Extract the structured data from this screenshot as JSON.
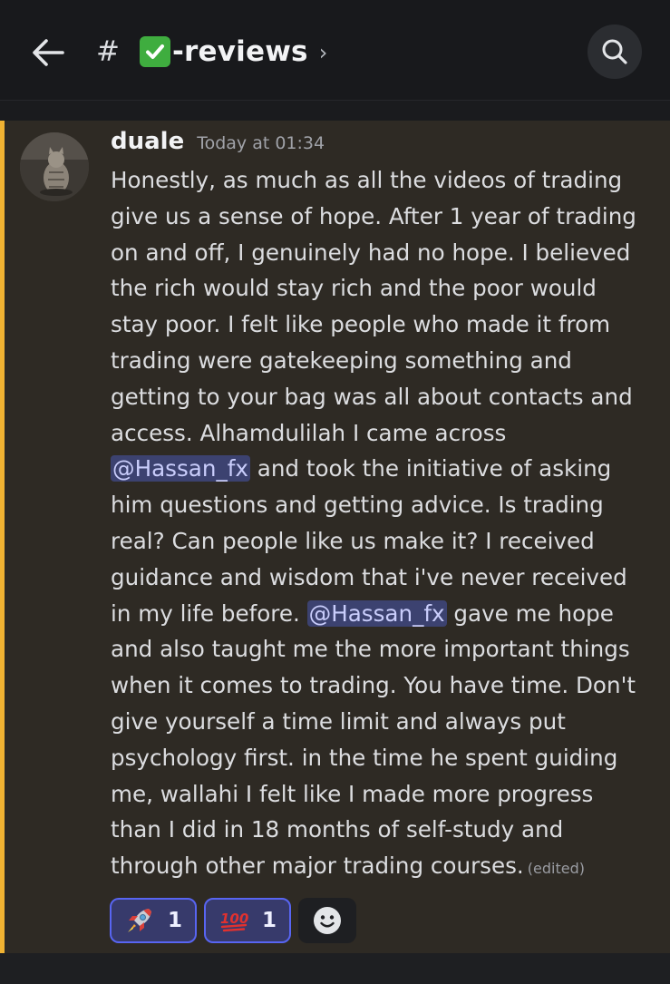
{
  "header": {
    "hash_symbol": "#",
    "channel_emoji": "white-check-mark-icon",
    "channel_name": "-reviews",
    "chevron": "›"
  },
  "message": {
    "author": "duale",
    "timestamp": "Today at 01:34",
    "lines": [
      "Honestly, as much as all the videos of trading",
      "give us a sense of hope. After 1 year of trading",
      "on and off, I genuinely had no hope. I believed",
      "the rich would stay rich and the poor would",
      "stay poor. I felt like people who made it from",
      "trading were gatekeeping something and",
      "getting to your bag was all about contacts and",
      "access. Alhamdulilah I came across"
    ],
    "mention1": "@Hassan_fx",
    "line9_rest": " and took the initiative of asking",
    "lines_b": [
      "him questions and getting advice. Is trading",
      "real? Can people like us make it? I received",
      "guidance and wisdom that i've never received"
    ],
    "line13_start": "in my life before. ",
    "mention2": "@Hassan_fx",
    "line13_rest": " gave me hope",
    "lines_c": [
      "and also taught me the more important things",
      "when it comes to trading. You have time. Don't",
      "give yourself a time limit and always put",
      "psychology first. in the time he spent guiding",
      "me, wallahi I felt like I made more progress",
      "than I did in 18 months of self-study and"
    ],
    "last_line": "through other major trading courses.",
    "edited": "(edited)"
  },
  "reactions": [
    {
      "emoji": "rocket-icon",
      "count": "1"
    },
    {
      "emoji": "hundred-points-icon",
      "count": "1"
    }
  ],
  "colors": {
    "highlight": "#f0b232",
    "mention_bg": "#3c4270",
    "reaction_border": "#5865f2"
  }
}
